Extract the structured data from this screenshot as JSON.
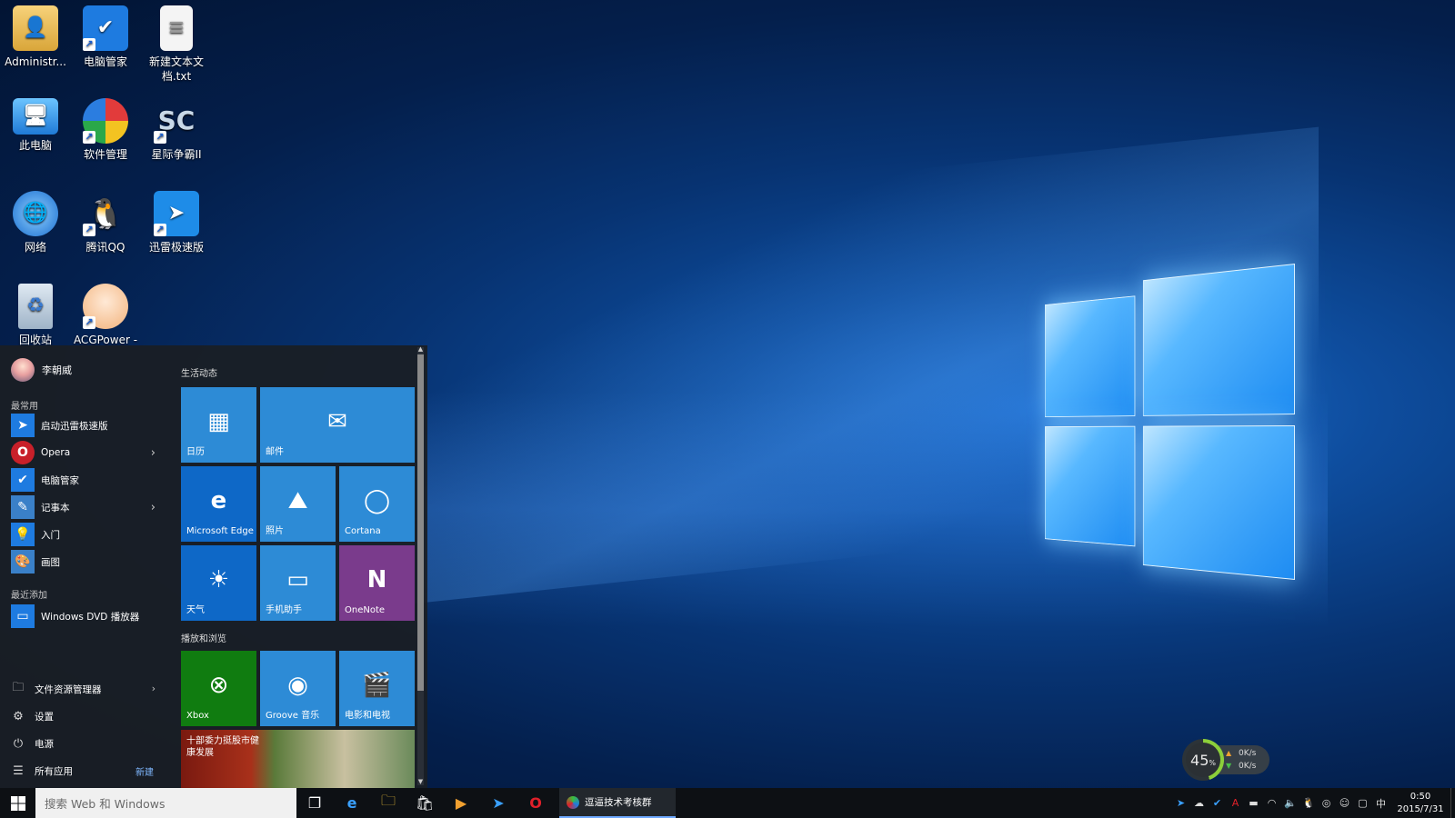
{
  "desktop": {
    "icons": [
      {
        "label": "Administr...",
        "icon": "user-folder-icon"
      },
      {
        "label": "电脑管家",
        "icon": "shield-icon"
      },
      {
        "label": "新建文本文档.txt",
        "icon": "text-file-icon"
      },
      {
        "label": "此电脑",
        "icon": "computer-icon"
      },
      {
        "label": "软件管理",
        "icon": "software-manager-icon"
      },
      {
        "label": "星际争霸II",
        "icon": "starcraft-icon"
      },
      {
        "label": "网络",
        "icon": "network-icon"
      },
      {
        "label": "腾讯QQ",
        "icon": "qq-penguin-icon"
      },
      {
        "label": "迅雷极速版",
        "icon": "thunder-bird-icon"
      },
      {
        "label": "回收站",
        "icon": "recycle-bin-icon"
      },
      {
        "label": "ACGPower -",
        "icon": "anime-avatar-icon"
      }
    ]
  },
  "start_menu": {
    "user_name": "李朝威",
    "most_used_label": "最常用",
    "most_used": [
      {
        "label": "启动迅雷极速版",
        "icon": "thunder-bird-icon",
        "color": "#1e7be0"
      },
      {
        "label": "Opera",
        "icon": "opera-icon",
        "color": "#c8202a"
      },
      {
        "label": "电脑管家",
        "icon": "shield-icon",
        "color": "#1e7be0"
      },
      {
        "label": "记事本",
        "icon": "notepad-icon",
        "color": "#3a80c8"
      },
      {
        "label": "入门",
        "icon": "lightbulb-icon",
        "color": "#1e7be0"
      },
      {
        "label": "画图",
        "icon": "paint-icon",
        "color": "#3a80c8"
      }
    ],
    "recently_added_label": "最近添加",
    "recently_added": [
      {
        "label": "Windows DVD 播放器",
        "icon": "dvd-icon",
        "color": "#1e7be0"
      }
    ],
    "bottom": {
      "file_explorer": "文件资源管理器",
      "settings": "设置",
      "power": "电源",
      "all_apps": "所有应用",
      "new_badge": "新建"
    },
    "groups": {
      "life": "生活动态",
      "play": "播放和浏览"
    },
    "tiles": {
      "calendar": "日历",
      "mail": "邮件",
      "edge": "Microsoft Edge",
      "photos": "照片",
      "cortana": "Cortana",
      "weather": "天气",
      "phone": "手机助手",
      "onenote": "OneNote",
      "xbox": "Xbox",
      "groove": "Groove 音乐",
      "movies": "电影和电视",
      "news": "十部委力挺股市健康发展"
    },
    "tile_colors": {
      "blue": "#2d8bd6",
      "dark_blue": "#0e68c7",
      "purple": "#7a3b8c",
      "green": "#107c10"
    }
  },
  "network_widget": {
    "percent": "45",
    "percent_unit": "%",
    "upload": "0K/s",
    "download": "0K/s"
  },
  "taskbar": {
    "search_placeholder": "搜索 Web 和 Windows",
    "active_task": "逗逼技术考核群",
    "tray_ime": "中",
    "time": "0:50",
    "date": "2015/7/31"
  }
}
